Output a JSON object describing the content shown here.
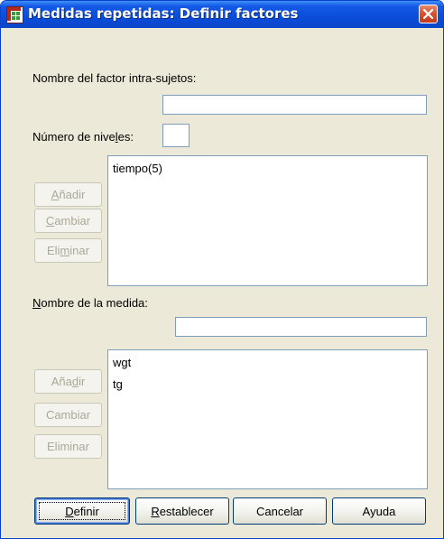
{
  "window": {
    "title": "Medidas repetidas: Definir factores",
    "icon": "spss-grid-icon",
    "close_icon": "close-icon"
  },
  "factor": {
    "name_label": "Nombre del factor intra-sujetos:",
    "name_value": "",
    "levels_label_pre": "Número de nive",
    "levels_label_mnemonic": "l",
    "levels_label_post": "es:",
    "levels_value": "",
    "list": [
      "tiempo(5)"
    ],
    "buttons": {
      "add": {
        "pre": "",
        "m": "A",
        "post": "ñadir"
      },
      "change": {
        "pre": "",
        "m": "C",
        "post": "ambiar"
      },
      "remove": {
        "pre": "Eli",
        "m": "m",
        "post": "inar"
      }
    }
  },
  "measure": {
    "name_label_mnemonic": "N",
    "name_label_post": "ombre de la medida:",
    "name_value": "",
    "list": [
      "wgt",
      "tg"
    ],
    "buttons": {
      "add": {
        "pre": "Aña",
        "m": "d",
        "post": "ir"
      },
      "change": "Cambiar",
      "remove": "Eliminar"
    }
  },
  "footer": {
    "define": {
      "pre": "",
      "m": "D",
      "post": "efinir"
    },
    "reset": {
      "pre": "",
      "m": "R",
      "post": "establecer"
    },
    "cancel": "Cancelar",
    "help": "Ayuda"
  },
  "colors": {
    "titlebar": "#0a4ddb",
    "dialog_bg": "#ece9d8",
    "input_border": "#7f9db9",
    "disabled_text": "#aca899"
  }
}
